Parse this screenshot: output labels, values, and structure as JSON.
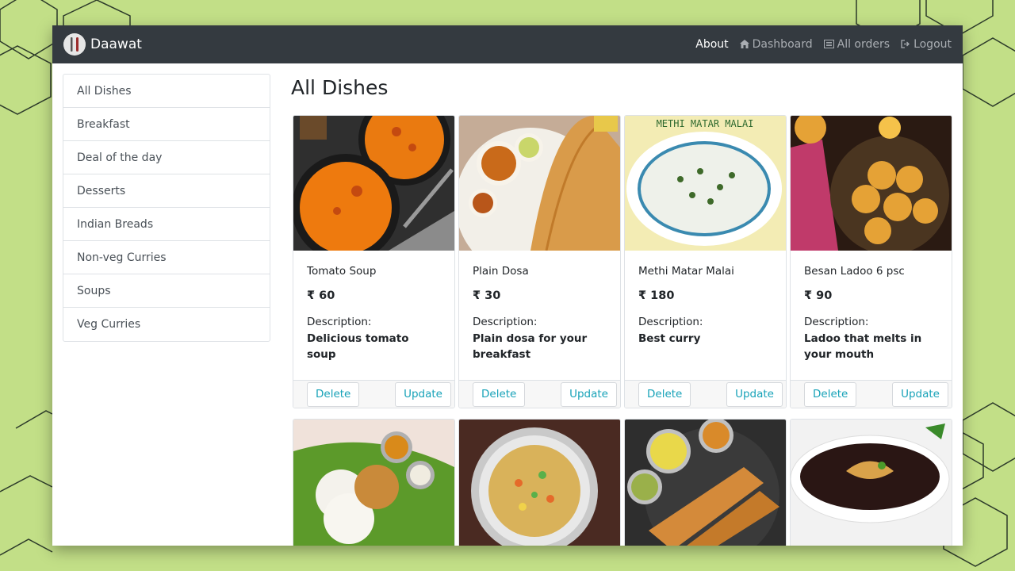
{
  "brand": {
    "name": "Daawat",
    "logo_icon": "fork-knife-logo-icon"
  },
  "nav": {
    "about": "About",
    "dashboard": "Dashboard",
    "all_orders": "All orders",
    "logout": "Logout"
  },
  "sidebar": {
    "items": [
      {
        "label": "All Dishes"
      },
      {
        "label": "Breakfast"
      },
      {
        "label": "Deal of the day"
      },
      {
        "label": "Desserts"
      },
      {
        "label": "Indian Breads"
      },
      {
        "label": "Non-veg Curries"
      },
      {
        "label": "Soups"
      },
      {
        "label": "Veg Curries"
      }
    ]
  },
  "main": {
    "title": "All Dishes",
    "dishes": [
      {
        "name": "Tomato Soup",
        "price": "₹ 60",
        "desc_label": "Description:",
        "desc": "Delicious tomato soup",
        "delete": "Delete",
        "update": "Update",
        "image": "tomato-soup-image"
      },
      {
        "name": "Plain Dosa",
        "price": "₹ 30",
        "desc_label": "Description:",
        "desc": "Plain dosa for your breakfast",
        "delete": "Delete",
        "update": "Update",
        "image": "plain-dosa-image"
      },
      {
        "name": "Methi Matar Malai",
        "price": "₹ 180",
        "desc_label": "Description:",
        "desc": "Best curry",
        "delete": "Delete",
        "update": "Update",
        "image": "methi-matar-malai-image",
        "image_caption": "METHI MATAR MALAI"
      },
      {
        "name": "Besan Ladoo 6 psc",
        "price": "₹ 90",
        "desc_label": "Description:",
        "desc": "Ladoo that melts in your mouth",
        "delete": "Delete",
        "update": "Update",
        "image": "besan-ladoo-image"
      },
      {
        "image": "idli-vada-image"
      },
      {
        "image": "veg-soup-image"
      },
      {
        "image": "masala-dosa-image"
      },
      {
        "image": "manchow-soup-image"
      }
    ]
  },
  "colors": {
    "navbar": "#343a40",
    "background": "#c2df87",
    "button_text": "#17a2b8"
  }
}
